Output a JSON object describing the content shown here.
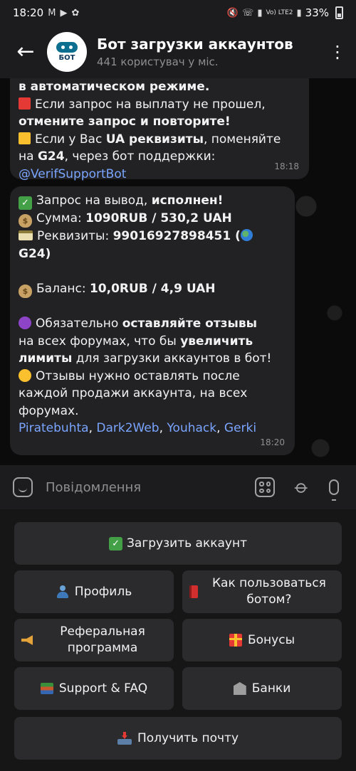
{
  "status_bar": {
    "time": "18:20",
    "battery": "33%",
    "network": "Vo) LTE2"
  },
  "header": {
    "back_icon": "arrow-left-icon",
    "avatar_text": "БОТ",
    "title": "Бот загрузки аккаунтов",
    "subtitle": "441 користувач у міс.",
    "menu_icon": "more-vertical-icon"
  },
  "messages": [
    {
      "lines": [
        {
          "parts": [
            {
              "t": "в автоматическом режиме.",
              "b": true
            }
          ]
        },
        {
          "icon": "red-square",
          "parts": [
            {
              "t": "Если запрос на выплату не прошел,"
            }
          ]
        },
        {
          "parts": [
            {
              "t": "отмените запрос и повторите!",
              "b": true
            }
          ]
        },
        {
          "icon": "yellow-square",
          "parts": [
            {
              "t": "Если у Вас "
            },
            {
              "t": "UA реквизиты",
              "b": true
            },
            {
              "t": ", поменяйте"
            }
          ]
        },
        {
          "parts": [
            {
              "t": "на "
            },
            {
              "t": "G24",
              "b": true
            },
            {
              "t": ", через бот поддержки:"
            }
          ]
        },
        {
          "parts": [
            {
              "t": "@VerifSupportBot",
              "link": true
            }
          ]
        }
      ],
      "time": "18:18"
    },
    {
      "lines": [
        {
          "icon": "check",
          "parts": [
            {
              "t": "Запрос на вывод, "
            },
            {
              "t": "исполнен!",
              "b": true
            }
          ]
        },
        {
          "icon": "money-bag",
          "parts": [
            {
              "t": "Сумма: "
            },
            {
              "t": "1090RUB  / 530,2 UAH",
              "b": true
            }
          ]
        },
        {
          "icon": "credit-card",
          "parts": [
            {
              "t": "Реквизиты: "
            },
            {
              "t": "99016927898451 (",
              "b": true
            },
            {
              "globe": true
            }
          ]
        },
        {
          "parts": [
            {
              "t": "G24)",
              "b": true
            }
          ]
        },
        {
          "blank": true
        },
        {
          "icon": "money-bag",
          "parts": [
            {
              "t": "Баланс: "
            },
            {
              "t": "10,0RUB  / 4,9 UAH",
              "b": true
            }
          ]
        },
        {
          "blank": true
        },
        {
          "icon": "purple-circle",
          "parts": [
            {
              "t": "Обязательно "
            },
            {
              "t": "оставляйте отзывы",
              "b": true
            }
          ]
        },
        {
          "parts": [
            {
              "t": "на всех форумах, что бы "
            },
            {
              "t": "увеличить",
              "b": true
            }
          ]
        },
        {
          "parts": [
            {
              "t": "лимиты",
              "b": true
            },
            {
              "t": " для загрузки аккаунтов в бот!"
            }
          ]
        },
        {
          "icon": "yellow-circle",
          "parts": [
            {
              "t": "Отзывы нужно оставлять после"
            }
          ]
        },
        {
          "parts": [
            {
              "t": "каждой продажи аккаунта, на всех"
            }
          ]
        },
        {
          "parts": [
            {
              "t": "форумах."
            }
          ]
        },
        {
          "parts": [
            {
              "t": "Piratebuhta",
              "link": true
            },
            {
              "t": ", "
            },
            {
              "t": "Dark2Web",
              "link": true
            },
            {
              "t": ", "
            },
            {
              "t": "Youhack",
              "link": true
            },
            {
              "t": ", "
            },
            {
              "t": "Gerki",
              "link": true
            }
          ]
        }
      ],
      "time": "18:20"
    }
  ],
  "input": {
    "placeholder": "Повідомлення",
    "icons": [
      "sticker-icon",
      "bot-keyboard-icon",
      "paperclip-icon",
      "microphone-icon"
    ]
  },
  "keyboard": {
    "buttons": [
      {
        "label": "Загрузить аккаунт",
        "icon": "check-icon"
      },
      {
        "label": "Профиль",
        "icon": "person-icon"
      },
      {
        "label": "Как пользоваться ботом?",
        "icon": "red-book-icon"
      },
      {
        "label": "Реферальная программа",
        "icon": "megaphone-icon"
      },
      {
        "label": "Бонусы",
        "icon": "gift-icon"
      },
      {
        "label": "Support & FAQ",
        "icon": "books-icon"
      },
      {
        "label": "Банки",
        "icon": "bank-icon"
      },
      {
        "label": "Получить почту",
        "icon": "inbox-tray-icon"
      }
    ]
  }
}
